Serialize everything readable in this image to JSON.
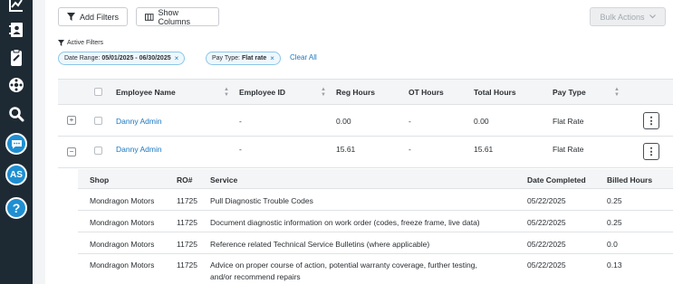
{
  "sidebar": {
    "icons": [
      "chart-icon",
      "contacts-icon",
      "clipboard-icon",
      "settings-icon",
      "search-icon",
      "chat-icon"
    ],
    "avatar_initials": "AS",
    "help_label": "?"
  },
  "toolbar": {
    "add_filters": "Add Filters",
    "show_columns": "Show Columns",
    "bulk_actions": "Bulk Actions"
  },
  "filters": {
    "label": "Active Filters",
    "chips": [
      {
        "key": "Date Range:",
        "value": "05/01/2025 - 06/30/2025"
      },
      {
        "key": "Pay Type:",
        "value": "Flat rate"
      }
    ],
    "clear_all": "Clear All"
  },
  "table": {
    "columns": [
      "Employee Name",
      "Employee ID",
      "Reg Hours",
      "OT Hours",
      "Total Hours",
      "Pay Type"
    ],
    "rows": [
      {
        "expander": "+",
        "name": "Danny Admin",
        "id": "-",
        "reg": "0.00",
        "ot": "-",
        "total": "0.00",
        "pay": "Flat Rate"
      },
      {
        "expander": "−",
        "name": "Danny Admin",
        "id": "-",
        "reg": "15.61",
        "ot": "-",
        "total": "15.61",
        "pay": "Flat Rate"
      }
    ]
  },
  "subtable": {
    "columns": [
      "Shop",
      "RO#",
      "Service",
      "Date Completed",
      "Billed Hours"
    ],
    "rows": [
      {
        "shop": "Mondragon Motors",
        "ro": "11725",
        "service": "Pull Diagnostic Trouble Codes",
        "service2": "",
        "date": "05/22/2025",
        "hours": "0.25"
      },
      {
        "shop": "Mondragon Motors",
        "ro": "11725",
        "service": "Document diagnostic information on work order (codes, freeze frame, live data)",
        "service2": "",
        "date": "05/22/2025",
        "hours": "0.25"
      },
      {
        "shop": "Mondragon Motors",
        "ro": "11725",
        "service": "Reference related Technical Service Bulletins (where applicable)",
        "service2": "",
        "date": "05/22/2025",
        "hours": "0.0"
      },
      {
        "shop": "Mondragon Motors",
        "ro": "11725",
        "service": "Advice on proper course of action, potential warranty coverage, further testing,",
        "service2": "and/or recommend repairs",
        "date": "05/22/2025",
        "hours": "0.13"
      }
    ]
  },
  "colors": {
    "accent": "#1a78c2",
    "sidebar": "#1e2a33",
    "avatar": "#1f8fd1"
  }
}
